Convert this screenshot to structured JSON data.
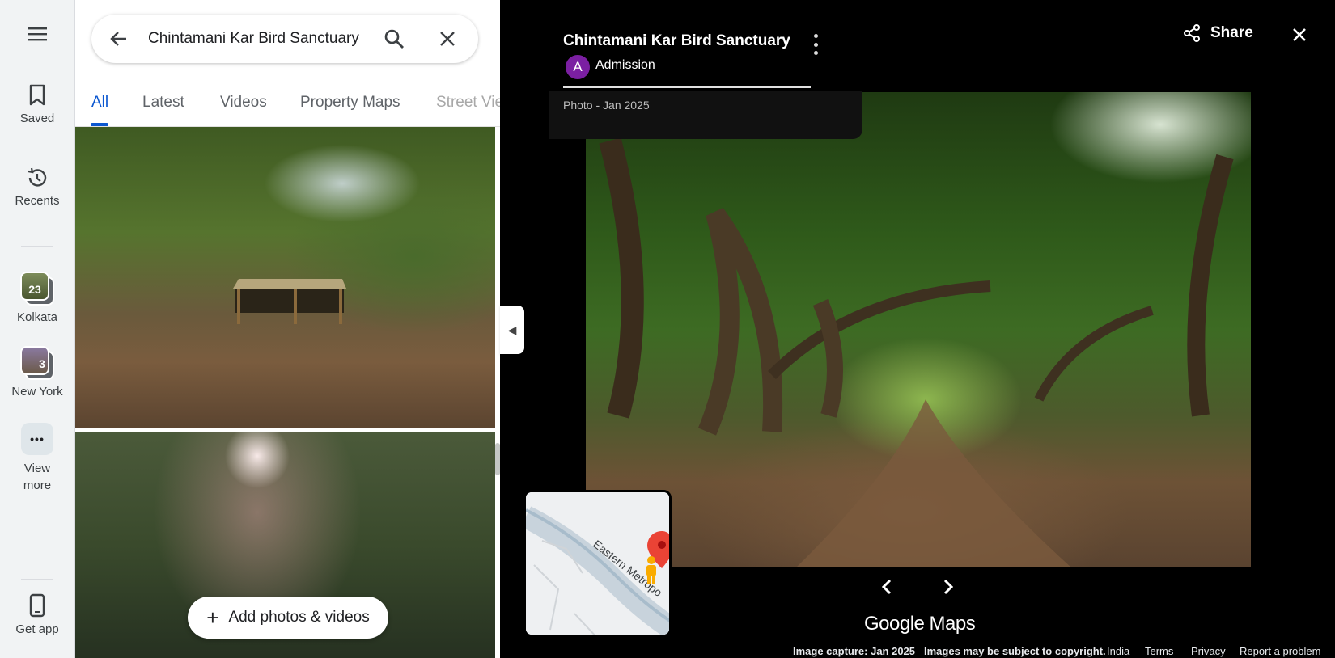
{
  "nav": {
    "menu_icon": "hamburger-menu-icon",
    "items": [
      {
        "label": "Saved",
        "icon": "bookmark-icon"
      },
      {
        "label": "Recents",
        "icon": "history-icon"
      },
      {
        "label": "Kolkata",
        "count": "23"
      },
      {
        "label": "New York",
        "count": "3"
      },
      {
        "label": "View more",
        "icon": "more-dots-icon"
      },
      {
        "label": "Get app",
        "icon": "phone-icon"
      }
    ]
  },
  "search": {
    "query": "Chintamani Kar Bird Sanctuary",
    "back_icon": "back-arrow-icon",
    "search_icon": "search-icon",
    "clear_icon": "close-icon"
  },
  "tabs": [
    "All",
    "Latest",
    "Videos",
    "Property Maps",
    "Street View"
  ],
  "active_tab": "All",
  "panel": {
    "add_photos_label": "Add photos & videos"
  },
  "viewer": {
    "title": "Chintamani Kar Bird Sanctuary",
    "author_initial": "A",
    "author": "Admission",
    "photo_date": "Photo - Jan 2025",
    "share_label": "Share",
    "brand": "Google Maps",
    "map_road_label": "Eastern Metropo",
    "footer": {
      "capture": "Image capture: Jan 2025",
      "copyright": "Images may be subject to copyright.",
      "links": [
        "India",
        "Terms",
        "Privacy",
        "Report a problem"
      ]
    }
  },
  "colors": {
    "accent": "#0b57d0",
    "avatar": "#7b1fa2",
    "pin": "#ea4335",
    "pegman": "#f9ab00"
  }
}
